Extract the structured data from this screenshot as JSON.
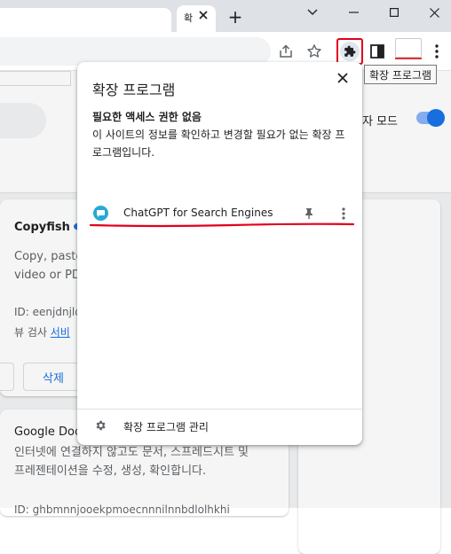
{
  "tabs": {
    "active_title": "확",
    "new_tab_symbol": "+"
  },
  "toolbar": {
    "tooltip": "확장 프로그램",
    "accent_color": "#e3001b"
  },
  "page": {
    "developer_mode_label": "자 모드",
    "extensions": [
      {
        "name": "Copyfish",
        "desc_lines": [
          "Copy, paste a",
          "video or PDF"
        ],
        "id_text": "ID: eenjdnjld",
        "links_prefix": "뷰 검사",
        "links_link": "서비",
        "remove_label": "삭제"
      },
      {
        "name": "Google Docs",
        "desc_lines": [
          "인터넷에 연결하지 않고도 문서, 스프레드시트 및",
          "프레젠테이션을 수정, 생성, 확인합니다."
        ],
        "id_text": "ID: ghbmnnjooekpmoecnnnilnnbdlolhkhi"
      }
    ]
  },
  "popup": {
    "title": "확장 프로그램",
    "subtitle": "필요한 액세스 권한 없음",
    "description": "이 사이트의 정보를 확인하고 변경할 필요가 없는 확장 프로그램입니다.",
    "items": [
      {
        "name": "ChatGPT for Search Engines",
        "icon": "chatgpt-extension-icon"
      }
    ],
    "manage_label": "확장 프로그램 관리",
    "annotation_color": "#e3001b"
  }
}
